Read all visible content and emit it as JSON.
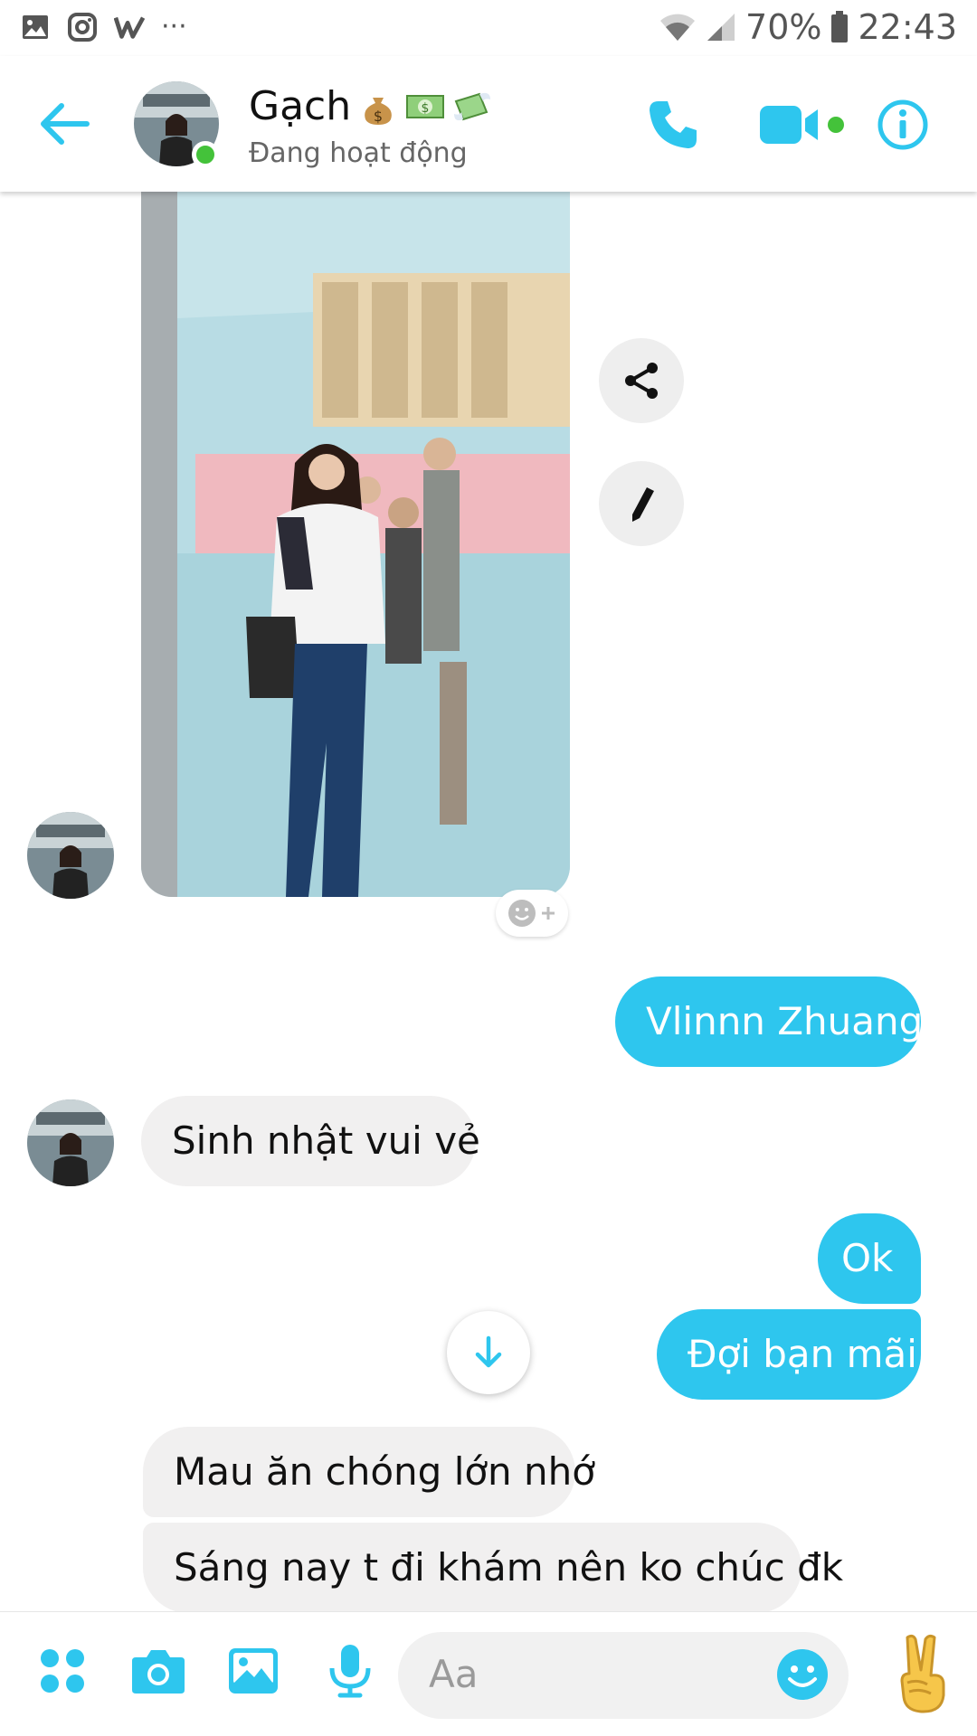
{
  "status_bar": {
    "battery": "70%",
    "time": "22:43",
    "dots": "···"
  },
  "header": {
    "contact_name": "Gạch",
    "status": "Đang hoạt động"
  },
  "messages": [
    {
      "direction": "out",
      "text": "Vlinnn Zhuang"
    },
    {
      "direction": "in",
      "text": "Sinh nhật vui vẻ"
    },
    {
      "direction": "out",
      "text": "Ok"
    },
    {
      "direction": "out",
      "text": "Đợi bạn mãi"
    },
    {
      "direction": "in",
      "text": "Mau ăn chóng lớn nhớ"
    },
    {
      "direction": "in",
      "text": "Sáng nay t đi khám nên ko chúc đk"
    }
  ],
  "composer": {
    "placeholder": "Aa"
  },
  "colors": {
    "accent": "#2ec6ee",
    "incoming_bubble": "#f1f0f0",
    "online": "#44c23a"
  },
  "icons": {
    "header": [
      "back-arrow-icon",
      "phone-icon",
      "video-camera-icon",
      "info-icon"
    ],
    "photo_actions": [
      "share-icon",
      "edit-pencil-icon"
    ],
    "composer": [
      "apps-grid-icon",
      "camera-icon",
      "gallery-icon",
      "microphone-icon",
      "emoji-icon",
      "peace-hand-icon"
    ]
  }
}
